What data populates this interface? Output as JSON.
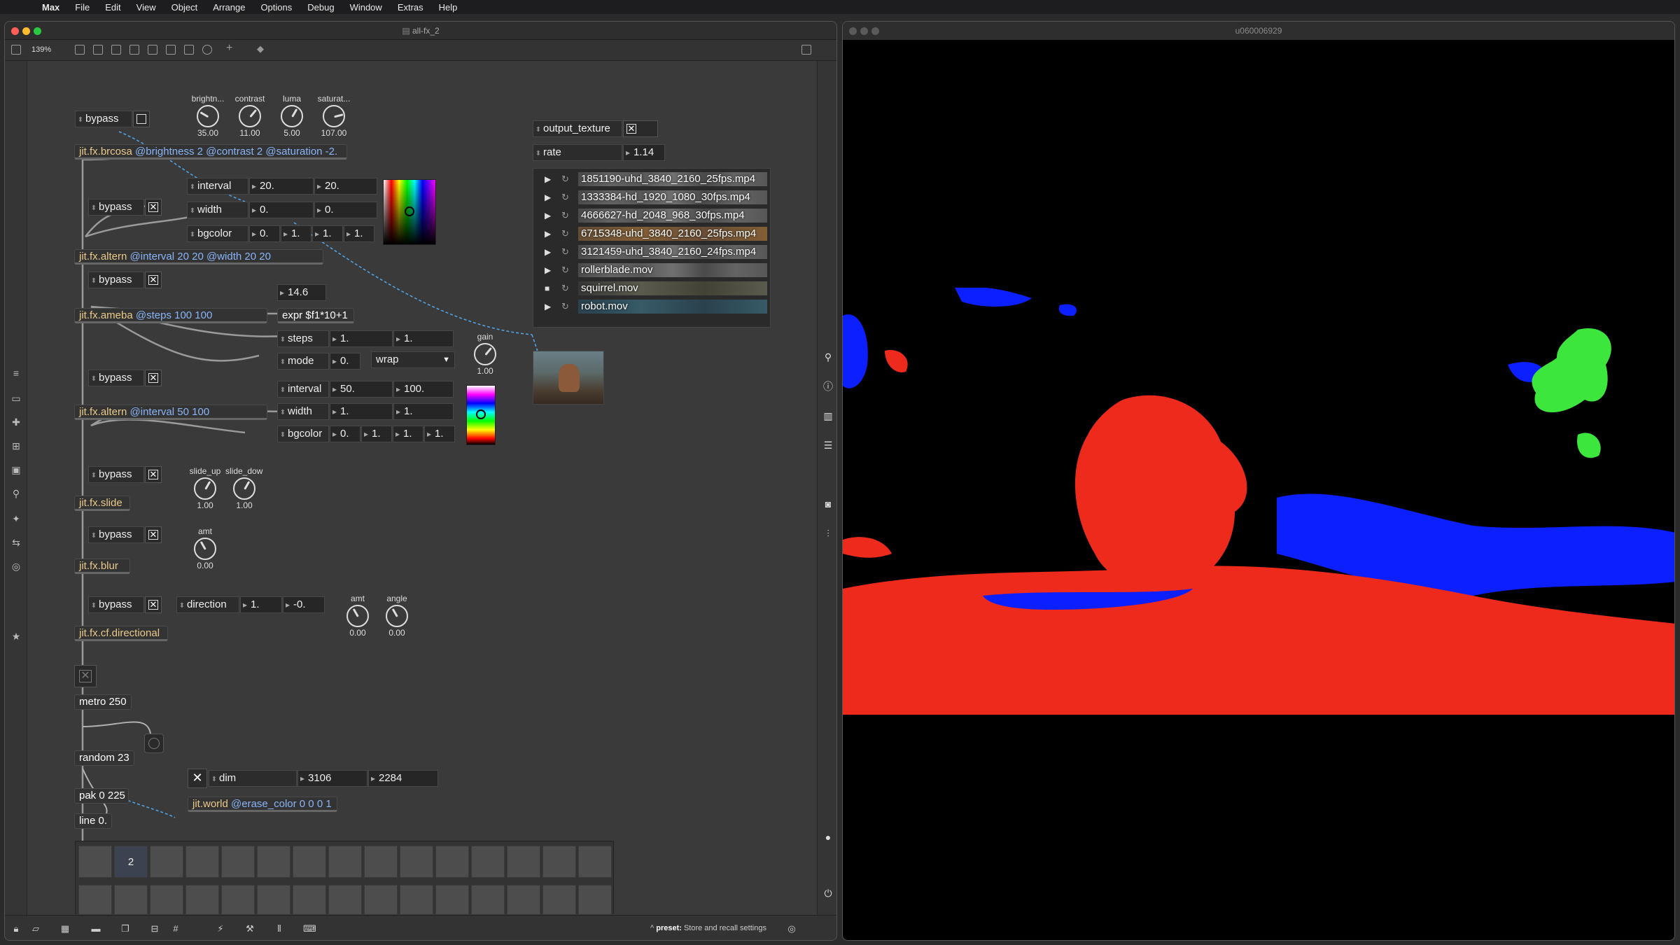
{
  "menubar": {
    "app": "Max",
    "items": [
      "File",
      "Edit",
      "View",
      "Object",
      "Arrange",
      "Options",
      "Debug",
      "Window",
      "Extras",
      "Help"
    ]
  },
  "editor": {
    "title": "all-fx_2",
    "zoom": "139%",
    "preset": {
      "bold": "preset:",
      "rest": " Store and recall settings"
    }
  },
  "patch": {
    "bypass": "bypass",
    "brcosa": {
      "t": "jit.fx.brcosa",
      "a": " @brightness 2 @contrast 2 @saturation -2."
    },
    "knobs1": [
      {
        "label": "brightn...",
        "value": "35.00"
      },
      {
        "label": "contrast",
        "value": "11.00"
      },
      {
        "label": "luma",
        "value": "5.00"
      },
      {
        "label": "saturat...",
        "value": "107.00"
      }
    ],
    "altern1": {
      "interval": "interval",
      "i1": "20.",
      "i2": "20.",
      "width": "width",
      "w1": "0.",
      "w2": "0.",
      "bgcolor": "bgcolor",
      "b1": "0.",
      "b2": "1.",
      "b3": "1.",
      "b4": "1.",
      "obj_t": "jit.fx.altern",
      "obj_a": " @interval 20 20 @width 20 20"
    },
    "ameba": {
      "t": "jit.fx.ameba",
      "a": " @steps 100 100"
    },
    "expr_num": "14.6",
    "expr": "expr $f1*10+1",
    "steps": {
      "label": "steps",
      "v1": "1.",
      "v2": "1."
    },
    "mode": {
      "label": "mode",
      "v1": "0.",
      "menu": "wrap"
    },
    "gain": {
      "label": "gain",
      "value": "1.00"
    },
    "altern2": {
      "interval": "interval",
      "i1": "50.",
      "i2": "100.",
      "width": "width",
      "w1": "1.",
      "w2": "1.",
      "bgcolor": "bgcolor",
      "b1": "0.",
      "b2": "1.",
      "b3": "1.",
      "b4": "1.",
      "obj_t": "jit.fx.altern",
      "obj_a": " @interval 50 100"
    },
    "slide": {
      "t": "jit.fx.slide",
      "k1": "slide_up",
      "v1": "1.00",
      "k2": "slide_down",
      "v2": "1.00"
    },
    "blur": {
      "t": "jit.fx.blur",
      "k": "amt",
      "v": "0.00"
    },
    "directional": {
      "t": "jit.fx.cf.directional",
      "direction": "direction",
      "d1": "1.",
      "d2": "-0.",
      "k1": "amt",
      "v1": "0.00",
      "k2": "angle",
      "v2": "0.00"
    },
    "metro": "metro 250",
    "random": "random 23",
    "pak": "pak 0 225",
    "line": "line 0.",
    "dim": {
      "label": "dim",
      "v1": "3106",
      "v2": "2284"
    },
    "world": {
      "t": "jit.world",
      "a": " @erase_color 0 0 0 1"
    },
    "output_texture": "output_texture",
    "rate": {
      "label": "rate",
      "value": "1.14"
    },
    "playlist": [
      "1851190-uhd_3840_2160_25fps.mp4",
      "1333384-hd_1920_1080_30fps.mp4",
      "4666627-hd_2048_968_30fps.mp4",
      "6715348-uhd_3840_2160_25fps.mp4",
      "3121459-uhd_3840_2160_24fps.mp4",
      "rollerblade.mov",
      "squirrel.mov",
      "robot.mov"
    ],
    "grid_selected": "2"
  },
  "jit_window": {
    "title": "u060006929"
  },
  "colors": {
    "object_text": "#e9c98a",
    "attribute": "#8ab4f8",
    "patch_cord_signal": "#4fa3e6"
  }
}
